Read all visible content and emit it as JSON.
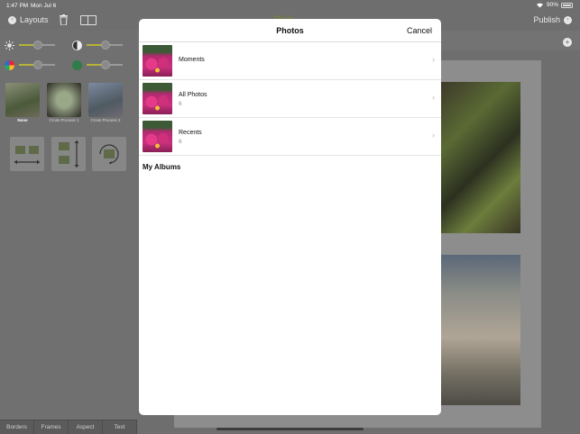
{
  "status_bar": {
    "time": "1:47 PM",
    "date": "Mon Jul 6",
    "battery": "90%"
  },
  "toolbar": {
    "back_label": "Layouts",
    "app_title": "Pixlr",
    "publish_label": "Publish"
  },
  "filters": [
    {
      "label": "None",
      "selected": true
    },
    {
      "label": "Cross Process 1",
      "selected": false
    },
    {
      "label": "Cross Process 2",
      "selected": false
    }
  ],
  "bottom_tabs": [
    "Borders",
    "Frames",
    "Aspect",
    "Text"
  ],
  "photos_modal": {
    "title": "Photos",
    "cancel_label": "Cancel",
    "albums": [
      {
        "name": "Moments",
        "count": ""
      },
      {
        "name": "All Photos",
        "count": "6"
      },
      {
        "name": "Recents",
        "count": "6"
      }
    ],
    "section_title": "My Albums"
  },
  "colors": {
    "accent_slider": "#b7b23a",
    "modal_bg": "#ffffff",
    "overlay": "#6e6e6e"
  },
  "icons": [
    "chevron-left-icon",
    "trash-icon",
    "split-view-icon",
    "chevron-right-icon",
    "plus-icon",
    "brightness-icon",
    "contrast-icon",
    "saturation-icon",
    "tint-icon",
    "flip-horizontal-icon",
    "flip-vertical-icon",
    "rotate-icon"
  ]
}
